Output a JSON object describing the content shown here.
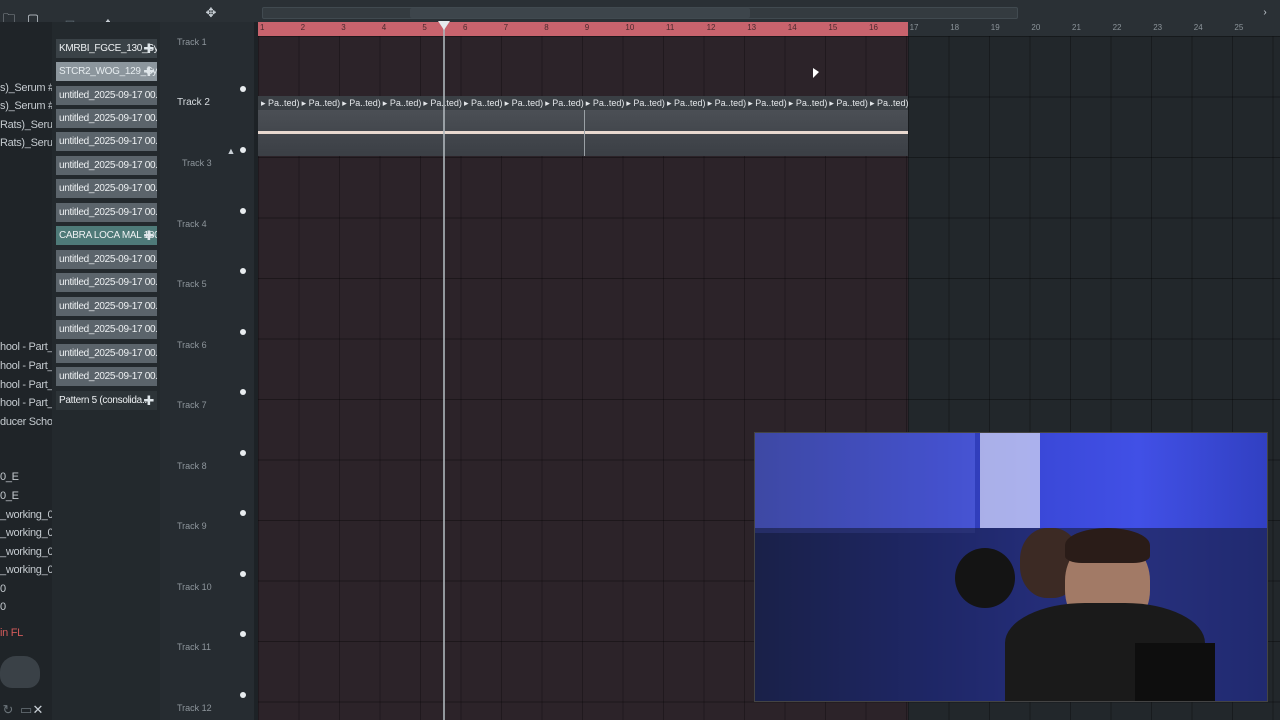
{
  "toolbar": {
    "icons": [
      "folder-icon",
      "pattern-icon",
      "plus-icon",
      "close-icon",
      "magnet-icon",
      "zoom-icon"
    ]
  },
  "browser": {
    "items": [
      "s)_Serum #7",
      "s)_Serum #7",
      "Rats)_Serum",
      "Rats)_Serum",
      "hool - Part_1",
      "hool - Part_2",
      "hool - Part_3",
      "hool - Part_4",
      "ducer School",
      "0_E",
      "0_E",
      "_working_01",
      "_working_01",
      "_working_02",
      "_working_02",
      "0",
      "0",
      "in FL"
    ]
  },
  "picker": {
    "clips": [
      "KMRBI_FGCE_130_Sy..",
      "STCR2_WOG_129_Syn..",
      "untitled_2025-09-17 00..",
      "untitled_2025-09-17 00..",
      "untitled_2025-09-17 00..",
      "untitled_2025-09-17 00..",
      "untitled_2025-09-17 00..",
      "untitled_2025-09-17 00..",
      "CABRA LOCA MAL 180..",
      "untitled_2025-09-17 00..",
      "untitled_2025-09-17 00..",
      "untitled_2025-09-17 00..",
      "untitled_2025-09-17 00..",
      "untitled_2025-09-17 00..",
      "untitled_2025-09-17 00..",
      "Pattern 5 (consolida.."
    ]
  },
  "tracks": [
    "Track 1",
    "Track 2",
    "Track 3",
    "Track 4",
    "Track 5",
    "Track 6",
    "Track 7",
    "Track 8",
    "Track 9",
    "Track 10",
    "Track 11",
    "Track 12"
  ],
  "ruler": [
    "1",
    "2",
    "3",
    "4",
    "5",
    "6",
    "7",
    "8",
    "9",
    "10",
    "11",
    "12",
    "13",
    "14",
    "15",
    "16",
    "17",
    "18",
    "19",
    "20",
    "21",
    "22",
    "23",
    "24",
    "25"
  ],
  "pattern_label": "Pa..ted)",
  "colors": {
    "ruler_active": "#c8636d",
    "grid": "#2c2329",
    "webcam_bg": "#3a48d8"
  }
}
